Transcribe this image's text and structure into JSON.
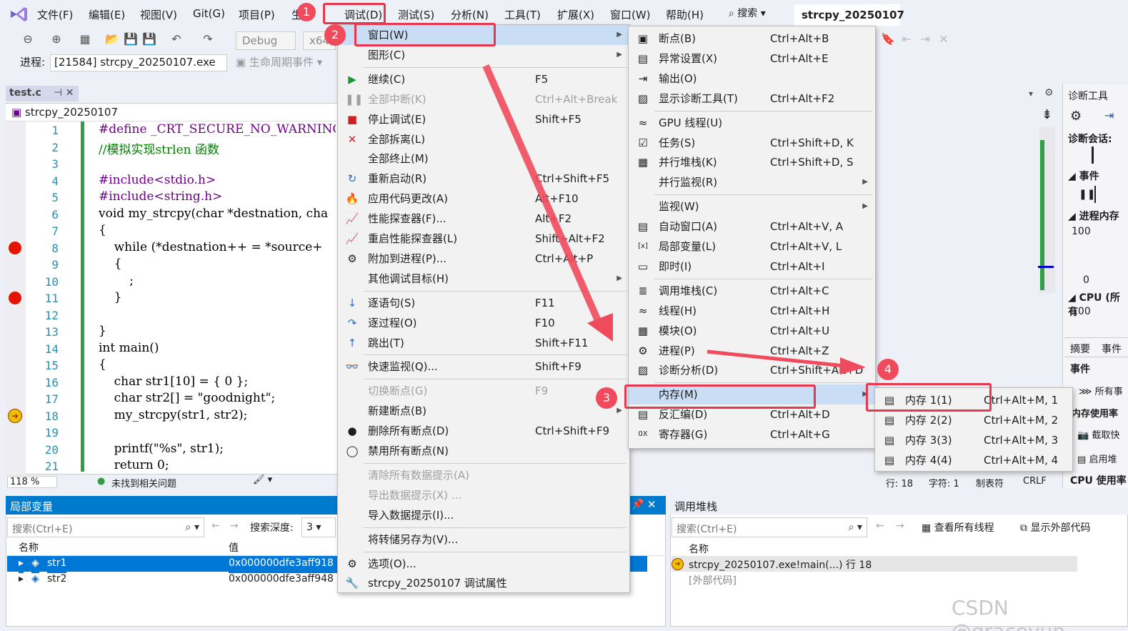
{
  "menubar": {
    "items": [
      "文件(F)",
      "编辑(E)",
      "视图(V)",
      "Git(G)",
      "项目(P)",
      "生",
      "调试(D)",
      "测试(S)",
      "分析(N)",
      "工具(T)",
      "扩展(X)",
      "窗口(W)",
      "帮助(H)"
    ],
    "search": "搜索",
    "solution": "strcpy_20250107"
  },
  "toolbar": {
    "config": "Debug",
    "platform": "x64",
    "process_label": "进程:",
    "process_value": "[21584] strcpy_20250107.exe",
    "lifecycle": "生命周期事件"
  },
  "editor": {
    "tab": "test.c",
    "nav": "strcpy_20250107",
    "zoom": "118 %",
    "status": "未找到相关问题",
    "lines": [
      {
        "n": "1",
        "t": "#define _CRT_SECURE_NO_WARNINGS 1"
      },
      {
        "n": "2",
        "t": "//模拟实现strlen 函数"
      },
      {
        "n": "3",
        "t": ""
      },
      {
        "n": "4",
        "t": "#include<stdio.h>"
      },
      {
        "n": "5",
        "t": "#include<string.h>"
      },
      {
        "n": "6",
        "t": "void my_strcpy(char *destnation, cha"
      },
      {
        "n": "7",
        "t": "{"
      },
      {
        "n": "8",
        "t": "    while (*destnation++ = *source+"
      },
      {
        "n": "9",
        "t": "    {"
      },
      {
        "n": "10",
        "t": "        ;"
      },
      {
        "n": "11",
        "t": "    }"
      },
      {
        "n": "12",
        "t": ""
      },
      {
        "n": "13",
        "t": "}"
      },
      {
        "n": "14",
        "t": "int main()"
      },
      {
        "n": "15",
        "t": "{"
      },
      {
        "n": "16",
        "t": "    char str1[10] = { 0 };"
      },
      {
        "n": "17",
        "t": "    char str2[] = \"goodnight\";"
      },
      {
        "n": "18",
        "t": "    my_strcpy(str1, str2);"
      },
      {
        "n": "19",
        "t": ""
      },
      {
        "n": "20",
        "t": "    printf(\"%s\", str1);"
      },
      {
        "n": "21",
        "t": "    return 0;"
      }
    ]
  },
  "debug_menu": [
    {
      "label": "窗口(W)",
      "shortcut": "",
      "arrow": true,
      "hl": true
    },
    {
      "label": "图形(C)",
      "shortcut": "",
      "arrow": true
    },
    {
      "label": "继续(C)",
      "shortcut": "F5",
      "icon": "▶"
    },
    {
      "label": "全部中断(K)",
      "shortcut": "Ctrl+Alt+Break",
      "icon": "❚❚",
      "dis": true
    },
    {
      "label": "停止调试(E)",
      "shortcut": "Shift+F5",
      "icon": "■"
    },
    {
      "label": "全部拆离(L)",
      "shortcut": "",
      "icon": "✕"
    },
    {
      "label": "全部终止(M)",
      "shortcut": ""
    },
    {
      "label": "重新启动(R)",
      "shortcut": "Ctrl+Shift+F5",
      "icon": "↻"
    },
    {
      "label": "应用代码更改(A)",
      "shortcut": "Alt+F10",
      "icon": "🔥"
    },
    {
      "label": "性能探查器(F)...",
      "shortcut": "Alt+F2",
      "icon": "📈"
    },
    {
      "label": "重启性能探查器(L)",
      "shortcut": "Shift+Alt+F2",
      "icon": "📈"
    },
    {
      "label": "附加到进程(P)...",
      "shortcut": "Ctrl+Alt+P",
      "icon": "⚙"
    },
    {
      "label": "其他调试目标(H)",
      "shortcut": "",
      "arrow": true
    },
    {
      "label": "逐语句(S)",
      "shortcut": "F11",
      "icon": "↓"
    },
    {
      "label": "逐过程(O)",
      "shortcut": "F10",
      "icon": "↷"
    },
    {
      "label": "跳出(T)",
      "shortcut": "Shift+F11",
      "icon": "↑"
    },
    {
      "label": "快速监视(Q)...",
      "shortcut": "Shift+F9",
      "icon": "👓"
    },
    {
      "label": "切换断点(G)",
      "shortcut": "F9",
      "dis": true
    },
    {
      "label": "新建断点(B)",
      "shortcut": "",
      "arrow": true
    },
    {
      "label": "删除所有断点(D)",
      "shortcut": "Ctrl+Shift+F9",
      "icon": "●"
    },
    {
      "label": "禁用所有断点(N)",
      "shortcut": "",
      "icon": "◯"
    },
    {
      "label": "清除所有数据提示(A)",
      "shortcut": "",
      "dis": true
    },
    {
      "label": "导出数据提示(X) ...",
      "shortcut": "",
      "dis": true
    },
    {
      "label": "导入数据提示(I)...",
      "shortcut": ""
    },
    {
      "label": "将转储另存为(V)...",
      "shortcut": ""
    },
    {
      "label": "选项(O)...",
      "shortcut": "",
      "icon": "⚙"
    },
    {
      "label": "strcpy_20250107 调试属性",
      "shortcut": "",
      "icon": "🔧"
    }
  ],
  "window_menu": [
    {
      "label": "断点(B)",
      "shortcut": "Ctrl+Alt+B",
      "icon": "▣"
    },
    {
      "label": "异常设置(X)",
      "shortcut": "Ctrl+Alt+E",
      "icon": "▤"
    },
    {
      "label": "输出(O)",
      "shortcut": "",
      "icon": "⇥"
    },
    {
      "label": "显示诊断工具(T)",
      "shortcut": "Ctrl+Alt+F2",
      "icon": "▨"
    },
    {
      "label": "GPU 线程(U)",
      "shortcut": "",
      "icon": "≈"
    },
    {
      "label": "任务(S)",
      "shortcut": "Ctrl+Shift+D, K",
      "icon": "☑"
    },
    {
      "label": "并行堆栈(K)",
      "shortcut": "Ctrl+Shift+D, S",
      "icon": "▦"
    },
    {
      "label": "并行监视(R)",
      "shortcut": "",
      "arrow": true
    },
    {
      "label": "监视(W)",
      "shortcut": "",
      "arrow": true
    },
    {
      "label": "自动窗口(A)",
      "shortcut": "Ctrl+Alt+V, A",
      "icon": "▤"
    },
    {
      "label": "局部变量(L)",
      "shortcut": "Ctrl+Alt+V, L",
      "icon": "[x]"
    },
    {
      "label": "即时(I)",
      "shortcut": "Ctrl+Alt+I",
      "icon": "▭"
    },
    {
      "label": "调用堆栈(C)",
      "shortcut": "Ctrl+Alt+C",
      "icon": "≣"
    },
    {
      "label": "线程(H)",
      "shortcut": "Ctrl+Alt+H",
      "icon": "≈"
    },
    {
      "label": "模块(O)",
      "shortcut": "Ctrl+Alt+U",
      "icon": "▦"
    },
    {
      "label": "进程(P)",
      "shortcut": "Ctrl+Alt+Z",
      "icon": "⚙"
    },
    {
      "label": "诊断分析(D)",
      "shortcut": "Ctrl+Shift+Alt+D",
      "icon": "▨"
    },
    {
      "label": "内存(M)",
      "shortcut": "",
      "arrow": true,
      "hl": true
    },
    {
      "label": "反汇编(D)",
      "shortcut": "Ctrl+Alt+D",
      "icon": "▤"
    },
    {
      "label": "寄存器(G)",
      "shortcut": "Ctrl+Alt+G",
      "icon": "0X"
    }
  ],
  "memory_menu": [
    {
      "label": "内存 1(1)",
      "shortcut": "Ctrl+Alt+M, 1"
    },
    {
      "label": "内存 2(2)",
      "shortcut": "Ctrl+Alt+M, 2"
    },
    {
      "label": "内存 3(3)",
      "shortcut": "Ctrl+Alt+M, 3"
    },
    {
      "label": "内存 4(4)",
      "shortcut": "Ctrl+Alt+M, 4"
    }
  ],
  "badges": [
    "1",
    "2",
    "3",
    "4"
  ],
  "right_panel": {
    "title": "诊断工具",
    "session": "诊断会话:",
    "events": "事件",
    "proc_mem": "进程内存",
    "v100": "100",
    "v0": "0",
    "cpu": "CPU (所有",
    "cpu100": "100",
    "tab_summary": "摘要",
    "tab_events": "事件",
    "events2": "事件",
    "all": "所有事",
    "mem_usage": "内存使用率",
    "snapshot": "截取快",
    "enable": "启用堆",
    "cpu_usage": "CPU 使用率"
  },
  "status": {
    "line": "行: 18",
    "char": "字符: 1",
    "tab": "制表符",
    "crlf": "CRLF"
  },
  "locals": {
    "title": "局部变量",
    "search": "搜索(Ctrl+E)",
    "depth_label": "搜索深度:",
    "depth": "3",
    "col_name": "名称",
    "col_value": "值",
    "rows": [
      {
        "name": "str1",
        "value": "0x000000dfe3aff918 \"\""
      },
      {
        "name": "str2",
        "value": "0x000000dfe3aff948 \"g"
      }
    ]
  },
  "callstack": {
    "title": "调用堆栈",
    "search": "搜索(Ctrl+E)",
    "all_threads": "查看所有线程",
    "ext_code": "显示外部代码",
    "col_name": "名称",
    "rows": [
      "strcpy_20250107.exe!main(...) 行 18",
      "[外部代码]"
    ]
  },
  "watermark": "CSDN @graceyun"
}
